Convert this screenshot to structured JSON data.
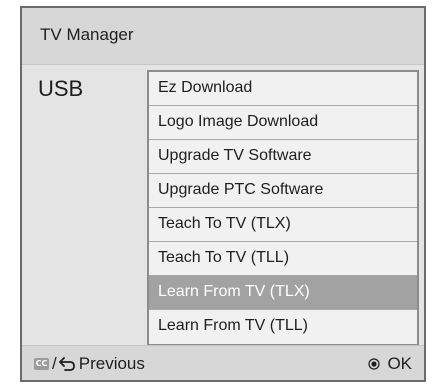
{
  "window": {
    "title": "TV Manager"
  },
  "source": {
    "label": "USB"
  },
  "menu": {
    "selected_index": 6,
    "items": [
      {
        "label": "Ez Download"
      },
      {
        "label": "Logo Image Download"
      },
      {
        "label": "Upgrade TV Software"
      },
      {
        "label": "Upgrade PTC Software"
      },
      {
        "label": "Teach To TV (TLX)"
      },
      {
        "label": "Teach To TV (TLL)"
      },
      {
        "label": "Learn From TV (TLX)"
      },
      {
        "label": "Learn From TV (TLL)"
      }
    ]
  },
  "footer": {
    "cc_icon_text": "CC",
    "separator": "/",
    "previous_label": "Previous",
    "ok_label": "OK",
    "icons": [
      "cc-icon",
      "back-arrow-icon",
      "ok-button-icon"
    ]
  },
  "colors": {
    "selected_item_background": "#a2a2a2",
    "panel_background": "#e4e4e4",
    "title_bar_background": "#d7d7d7"
  }
}
